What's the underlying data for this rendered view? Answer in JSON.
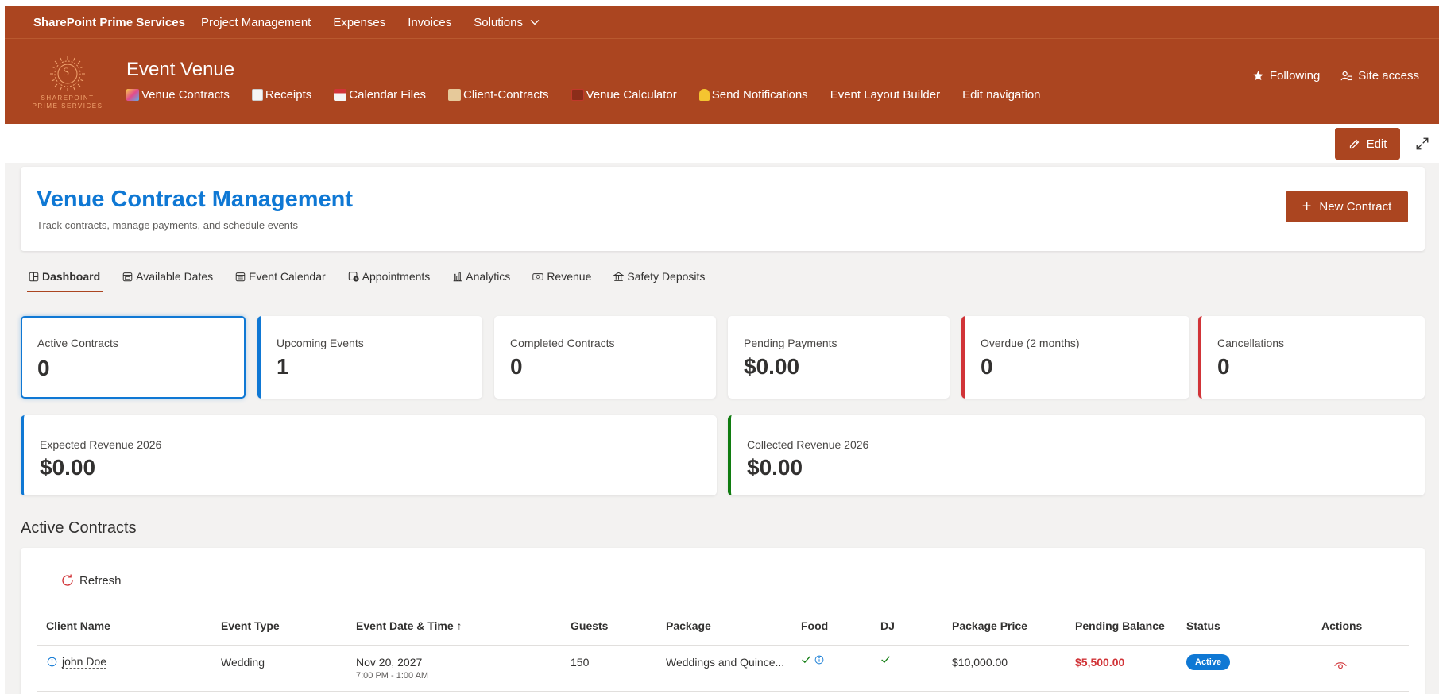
{
  "suite": {
    "brand": "SharePoint Prime Services",
    "nav": [
      "Project Management",
      "Expenses",
      "Invoices",
      "Solutions"
    ]
  },
  "site": {
    "logo_letter": "S",
    "logo_text_1": "SHAREPOINT",
    "logo_text_2": "PRIME SERVICES",
    "title": "Event Venue",
    "nav": [
      {
        "label": "Venue Contracts",
        "icon": "confetti-icon"
      },
      {
        "label": "Receipts",
        "icon": "receipt-icon"
      },
      {
        "label": "Calendar Files",
        "icon": "calendar-icon"
      },
      {
        "label": "Client-Contracts",
        "icon": "scroll-icon"
      },
      {
        "label": "Venue Calculator",
        "icon": "abacus-icon"
      },
      {
        "label": "Send Notifications",
        "icon": "bell-icon"
      },
      {
        "label": "Event Layout Builder"
      },
      {
        "label": "Edit navigation"
      }
    ],
    "following": "Following",
    "site_access": "Site access"
  },
  "cmd": {
    "edit": "Edit"
  },
  "page": {
    "title": "Venue Contract Management",
    "subtitle": "Track contracts, manage payments, and schedule events",
    "new_contract": "New Contract"
  },
  "tabs": [
    "Dashboard",
    "Available Dates",
    "Event Calendar",
    "Appointments",
    "Analytics",
    "Revenue",
    "Safety Deposits"
  ],
  "stats": [
    {
      "label": "Active Contracts",
      "value": "0"
    },
    {
      "label": "Upcoming Events",
      "value": "1"
    },
    {
      "label": "Completed Contracts",
      "value": "0"
    },
    {
      "label": "Pending Payments",
      "value": "$0.00"
    },
    {
      "label": "Overdue (2 months)",
      "value": "0"
    },
    {
      "label": "Cancellations",
      "value": "0"
    }
  ],
  "revenue": [
    {
      "label": "Expected Revenue 2026",
      "value": "$0.00"
    },
    {
      "label": "Collected Revenue 2026",
      "value": "$0.00"
    }
  ],
  "section_title": "Active Contracts",
  "table": {
    "refresh": "Refresh",
    "columns": [
      "Client Name",
      "Event Type",
      "Event Date & Time ↑",
      "Guests",
      "Package",
      "Food",
      "DJ",
      "Package Price",
      "Pending Balance",
      "Status",
      "Actions"
    ],
    "rows": [
      {
        "client": "john Doe",
        "event_type": "Wedding",
        "date": "Nov 20, 2027",
        "time": "7:00 PM - 1:00 AM",
        "guests": "150",
        "package": "Weddings and Quince...",
        "price": "$10,000.00",
        "balance": "$5,500.00",
        "status": "Active"
      }
    ]
  },
  "colors": {
    "brand": "#ab4520",
    "accent": "#0f78d4",
    "danger": "#d13438",
    "success": "#107c10"
  }
}
